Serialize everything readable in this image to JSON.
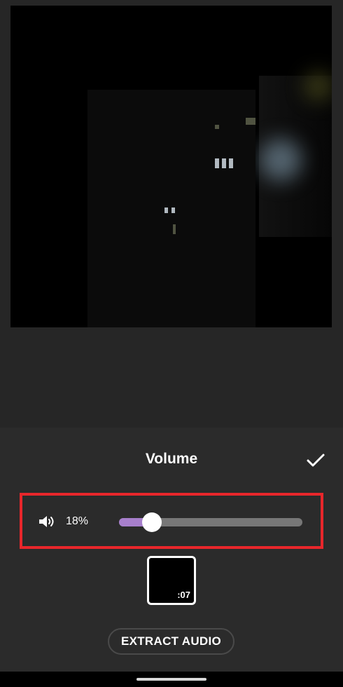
{
  "panel": {
    "title": "Volume"
  },
  "volume": {
    "label": "18%",
    "level": 0.18,
    "icon": "speaker-icon",
    "accent_color": "#a77fcc"
  },
  "clip": {
    "duration": ":07"
  },
  "actions": {
    "extract_audio": "EXTRACT AUDIO",
    "confirm_icon": "checkmark-icon"
  },
  "highlight_color": "#e8262b"
}
